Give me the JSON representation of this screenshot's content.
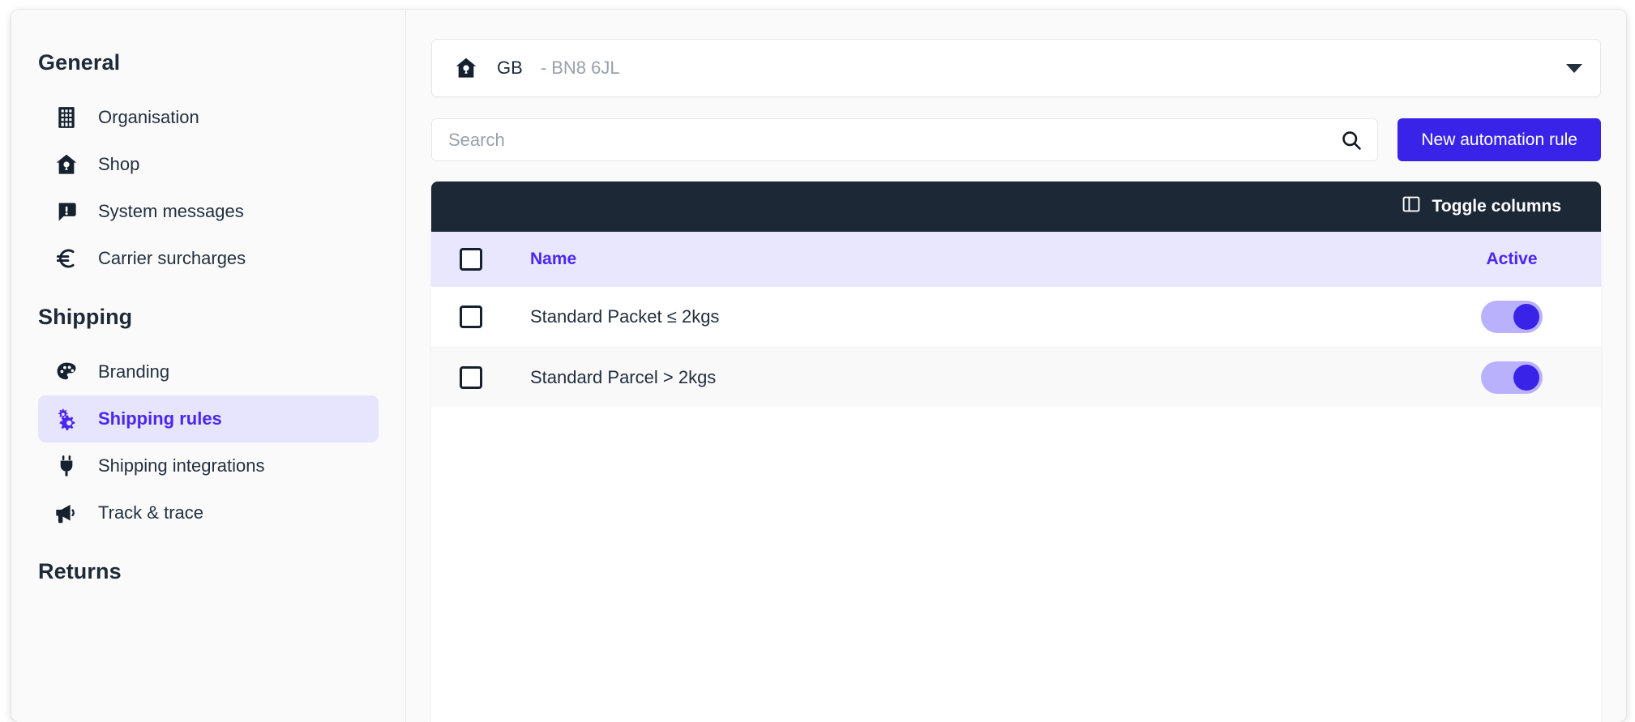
{
  "sidebar": {
    "sections": [
      {
        "title": "General",
        "items": [
          {
            "label": "Organisation",
            "icon": "building-icon",
            "active": false
          },
          {
            "label": "Shop",
            "icon": "shop-home-icon",
            "active": false
          },
          {
            "label": "System messages",
            "icon": "message-alert-icon",
            "active": false
          },
          {
            "label": "Carrier surcharges",
            "icon": "euro-icon",
            "active": false
          }
        ]
      },
      {
        "title": "Shipping",
        "items": [
          {
            "label": "Branding",
            "icon": "palette-icon",
            "active": false
          },
          {
            "label": "Shipping rules",
            "icon": "gears-icon",
            "active": true
          },
          {
            "label": "Shipping integrations",
            "icon": "plug-icon",
            "active": false
          },
          {
            "label": "Track & trace",
            "icon": "megaphone-icon",
            "active": false
          }
        ]
      },
      {
        "title": "Returns",
        "items": []
      }
    ]
  },
  "location_select": {
    "icon": "shop-home-icon",
    "country": "GB",
    "separator_and_postcode": " - BN8 6JL",
    "caret_icon": "chevron-down-icon"
  },
  "search": {
    "placeholder": "Search",
    "value": "",
    "icon": "search-icon"
  },
  "toolbar": {
    "new_rule_label": "New automation rule",
    "toggle_columns_label": "Toggle columns",
    "toggle_columns_icon": "columns-icon"
  },
  "table": {
    "columns": [
      "Name",
      "Active"
    ],
    "select_all_checked": false,
    "rows": [
      {
        "name": "Standard Packet ≤ 2kgs",
        "checked": false,
        "active": true
      },
      {
        "name": "Standard Parcel > 2kgs",
        "checked": false,
        "active": true
      }
    ]
  },
  "colors": {
    "accent": "#3a23e8",
    "accent_text": "#4b26ee",
    "header_bg": "#1d2836",
    "row_header_bg": "#e9e7fd",
    "sidebar_active_bg": "#e7e5fd",
    "switch_track": "#b9b1fb"
  }
}
